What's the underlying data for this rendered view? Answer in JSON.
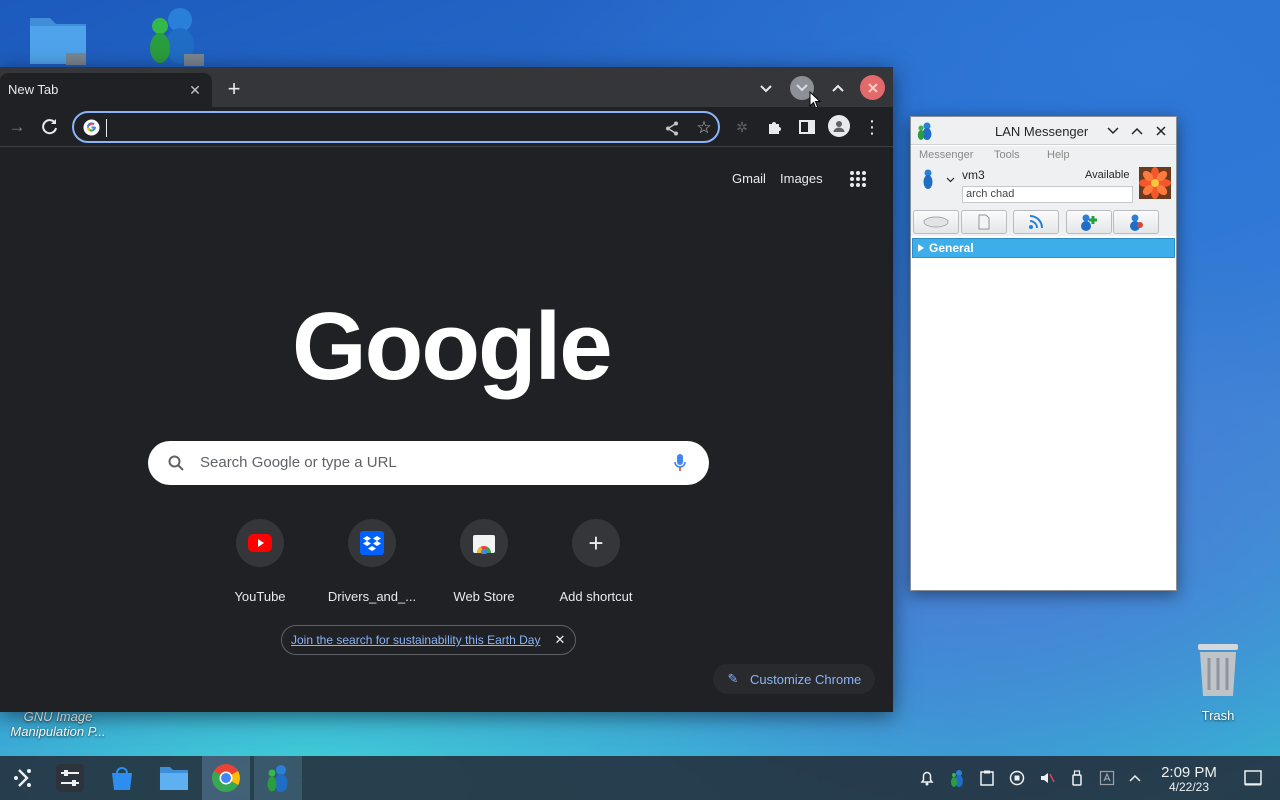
{
  "desktop": {
    "icons": [
      {
        "name": "GNU Image Manipulation P..."
      },
      {
        "name": "Trash"
      }
    ]
  },
  "chrome": {
    "tab_title": "New Tab",
    "omnibox_value": "",
    "top_links": {
      "gmail": "Gmail",
      "images": "Images"
    },
    "search_placeholder": "Search Google or type a URL",
    "shortcuts": [
      {
        "label": "YouTube"
      },
      {
        "label": "Drivers_and_..."
      },
      {
        "label": "Web Store"
      },
      {
        "label": "Add shortcut"
      }
    ],
    "promo_text": "Join the search for sustainability this Earth Day",
    "customize_label": "Customize Chrome",
    "logo_text": "Google"
  },
  "lan_messenger": {
    "title": "LAN Messenger",
    "menu": [
      "Messenger",
      "Tools",
      "Help"
    ],
    "user_name": "vm3",
    "status": "Available",
    "note_value": "arch chad",
    "group_label": "General"
  },
  "taskbar": {
    "time": "2:09 PM",
    "date": "4/22/23"
  }
}
